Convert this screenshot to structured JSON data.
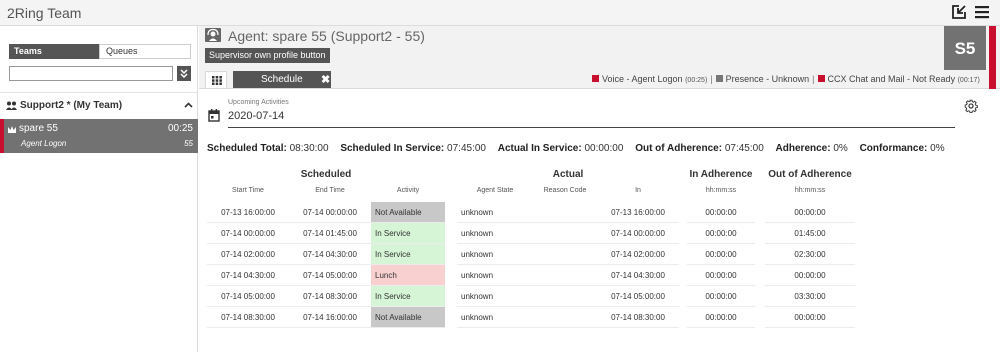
{
  "app": {
    "title": "2Ring Team"
  },
  "left_panel": {
    "tabs": [
      "Teams",
      "Queues"
    ],
    "search_value": "",
    "group": {
      "label": "Support2 * (My Team)"
    },
    "agent": {
      "name": "spare 55",
      "timer": "00:25",
      "state": "Agent Logon",
      "extension": "55"
    }
  },
  "header": {
    "agent_title": "Agent: spare 55 (Support2 - 55)",
    "supervisor_button": "Supervisor own profile button",
    "schedule_tab": "Schedule",
    "schedule_close": "✖",
    "avatar": "S5",
    "status": [
      {
        "label": "Voice - Agent Logon",
        "time": "(00:25)",
        "color": "#c8102e"
      },
      {
        "label": "Presence - Unknown",
        "time": "",
        "color": "#777777"
      },
      {
        "label": "CCX Chat and Mail - Not Ready",
        "time": "(00:17)",
        "color": "#c8102e"
      }
    ],
    "status_separator": "|"
  },
  "content": {
    "upcoming_label": "Upcoming Activities",
    "date": "2020-07-14",
    "summary": [
      {
        "label": "Scheduled Total:",
        "value": "08:30:00"
      },
      {
        "label": "Scheduled In Service:",
        "value": "07:45:00"
      },
      {
        "label": "Actual In Service:",
        "value": "00:00:00"
      },
      {
        "label": "Out of Adherence:",
        "value": "07:45:00"
      },
      {
        "label": "Adherence:",
        "value": "0%"
      },
      {
        "label": "Conformance:",
        "value": "0%"
      }
    ],
    "groups": {
      "scheduled": "Scheduled",
      "actual": "Actual",
      "in_adherence": "In Adherence",
      "out_adherence": "Out of Adherence"
    },
    "columns": {
      "start": "Start Time",
      "end": "End Time",
      "activity": "Activity",
      "agent_state": "Agent State",
      "reason": "Reason Code",
      "in": "In",
      "in_adh": "hh:mm:ss",
      "out_adh": "hh:mm:ss"
    },
    "rows": [
      {
        "start": "07-13 16:00:00",
        "end": "07-14 00:00:00",
        "activity": "Not Available",
        "activity_type": "na",
        "agent_state": "unknown",
        "reason": "",
        "in": "07-13 16:00:00",
        "in_adh": "00:00:00",
        "out_adh": "00:00:00"
      },
      {
        "start": "07-14 00:00:00",
        "end": "07-14 01:45:00",
        "activity": "In Service",
        "activity_type": "in",
        "agent_state": "unknown",
        "reason": "",
        "in": "07-14 00:00:00",
        "in_adh": "00:00:00",
        "out_adh": "01:45:00"
      },
      {
        "start": "07-14 02:00:00",
        "end": "07-14 04:30:00",
        "activity": "In Service",
        "activity_type": "in",
        "agent_state": "unknown",
        "reason": "",
        "in": "07-14 02:00:00",
        "in_adh": "00:00:00",
        "out_adh": "02:30:00"
      },
      {
        "start": "07-14 04:30:00",
        "end": "07-14 05:00:00",
        "activity": "Lunch",
        "activity_type": "lunch",
        "agent_state": "unknown",
        "reason": "",
        "in": "07-14 04:30:00",
        "in_adh": "00:00:00",
        "out_adh": "00:00:00"
      },
      {
        "start": "07-14 05:00:00",
        "end": "07-14 08:30:00",
        "activity": "In Service",
        "activity_type": "in",
        "agent_state": "unknown",
        "reason": "",
        "in": "07-14 05:00:00",
        "in_adh": "00:00:00",
        "out_adh": "03:30:00"
      },
      {
        "start": "07-14 08:30:00",
        "end": "07-14 16:00:00",
        "activity": "Not Available",
        "activity_type": "na",
        "agent_state": "unknown",
        "reason": "",
        "in": "07-14 08:30:00",
        "in_adh": "00:00:00",
        "out_adh": "00:00:00"
      }
    ]
  }
}
